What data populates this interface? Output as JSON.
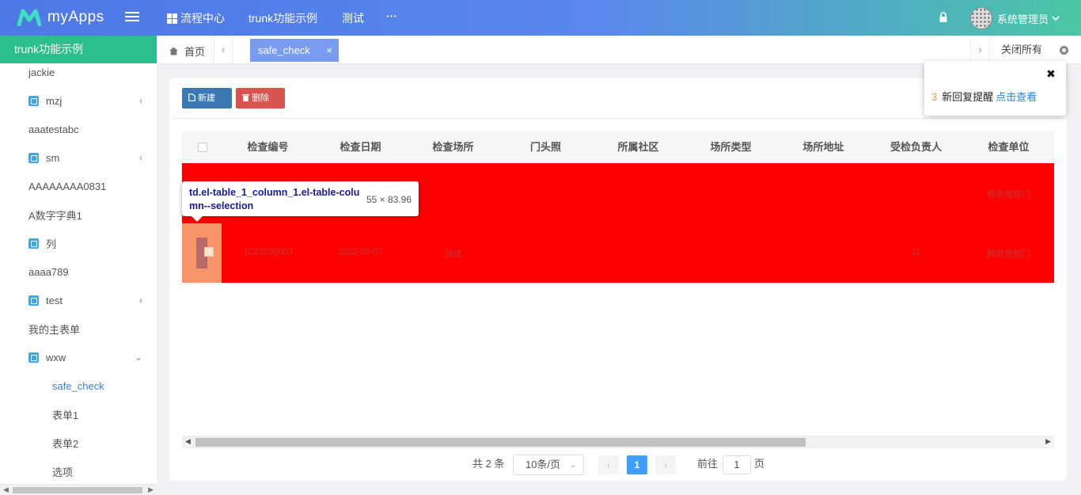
{
  "app": {
    "title": "myApps"
  },
  "header": {
    "nav": [
      "流程中心",
      "trunk功能示例",
      "测试",
      "···"
    ],
    "user_name": "系统管理员"
  },
  "sidebar": {
    "title": "trunk功能示例",
    "items": [
      {
        "label": "jackie",
        "icon": "",
        "arrow": ""
      },
      {
        "label": "mzj",
        "icon": "module-icon",
        "arrow": "‹"
      },
      {
        "label": "aaatestabc",
        "icon": "",
        "arrow": ""
      },
      {
        "label": "sm",
        "icon": "module-icon",
        "arrow": "‹"
      },
      {
        "label": "AAAAAAAA0831",
        "icon": "",
        "arrow": ""
      },
      {
        "label": "A数字字典1",
        "icon": "",
        "arrow": ""
      },
      {
        "label": "列",
        "icon": "module-icon",
        "arrow": ""
      },
      {
        "label": "aaaa789",
        "icon": "",
        "arrow": ""
      },
      {
        "label": "test",
        "icon": "module-icon",
        "arrow": "‹"
      },
      {
        "label": "我的主表单",
        "icon": "",
        "arrow": ""
      },
      {
        "label": "wxw",
        "icon": "module-icon",
        "arrow": "⌄"
      },
      {
        "label": "safe_check",
        "icon": "",
        "arrow": ""
      },
      {
        "label": "表单1",
        "icon": "",
        "arrow": ""
      },
      {
        "label": "表单2",
        "icon": "",
        "arrow": ""
      },
      {
        "label": "选项",
        "icon": "",
        "arrow": ""
      }
    ]
  },
  "tabs": {
    "home": "首页",
    "active": "safe_check",
    "close_active": "×",
    "close_all": "关闭所有"
  },
  "toolbar": {
    "new_label": "新建",
    "delete_label": "删除"
  },
  "table": {
    "columns": [
      "检查编号",
      "检查日期",
      "检查场所",
      "门头照",
      "所属社区",
      "场所类型",
      "场所地址",
      "受检负责人",
      "检查单位"
    ],
    "rows": [
      [
        "",
        "",
        "",
        "",
        "",
        "",
        "",
        "",
        "胖奇奇部门"
      ],
      [
        "JC22050003",
        "2022-05-07",
        "测试",
        "",
        "",
        "",
        "",
        "11",
        "胖奇奇部门"
      ]
    ]
  },
  "inspector_tooltip": {
    "selector": "td.el-table_1_column_1.el-table-column--selection",
    "size": "55 × 83.96"
  },
  "pagination": {
    "total": "共 2 条",
    "page_size": "10条/页",
    "prev": "‹",
    "current": "1",
    "next": "›",
    "goto_prefix": "前往",
    "goto_value": "1",
    "goto_suffix": "页"
  },
  "notification": {
    "count": "3",
    "text": "新回复提醒",
    "link": "点击查看"
  },
  "colors": {
    "header_start": "#4e79e6",
    "header_end": "#4ac7a5",
    "sidebar_title": "#2bbf8c",
    "active_tab": "#7a9cf0",
    "btn_new": "#3c77b6",
    "btn_delete": "#d9534f",
    "highlight": "#ff0000",
    "page_current": "#409eff"
  }
}
